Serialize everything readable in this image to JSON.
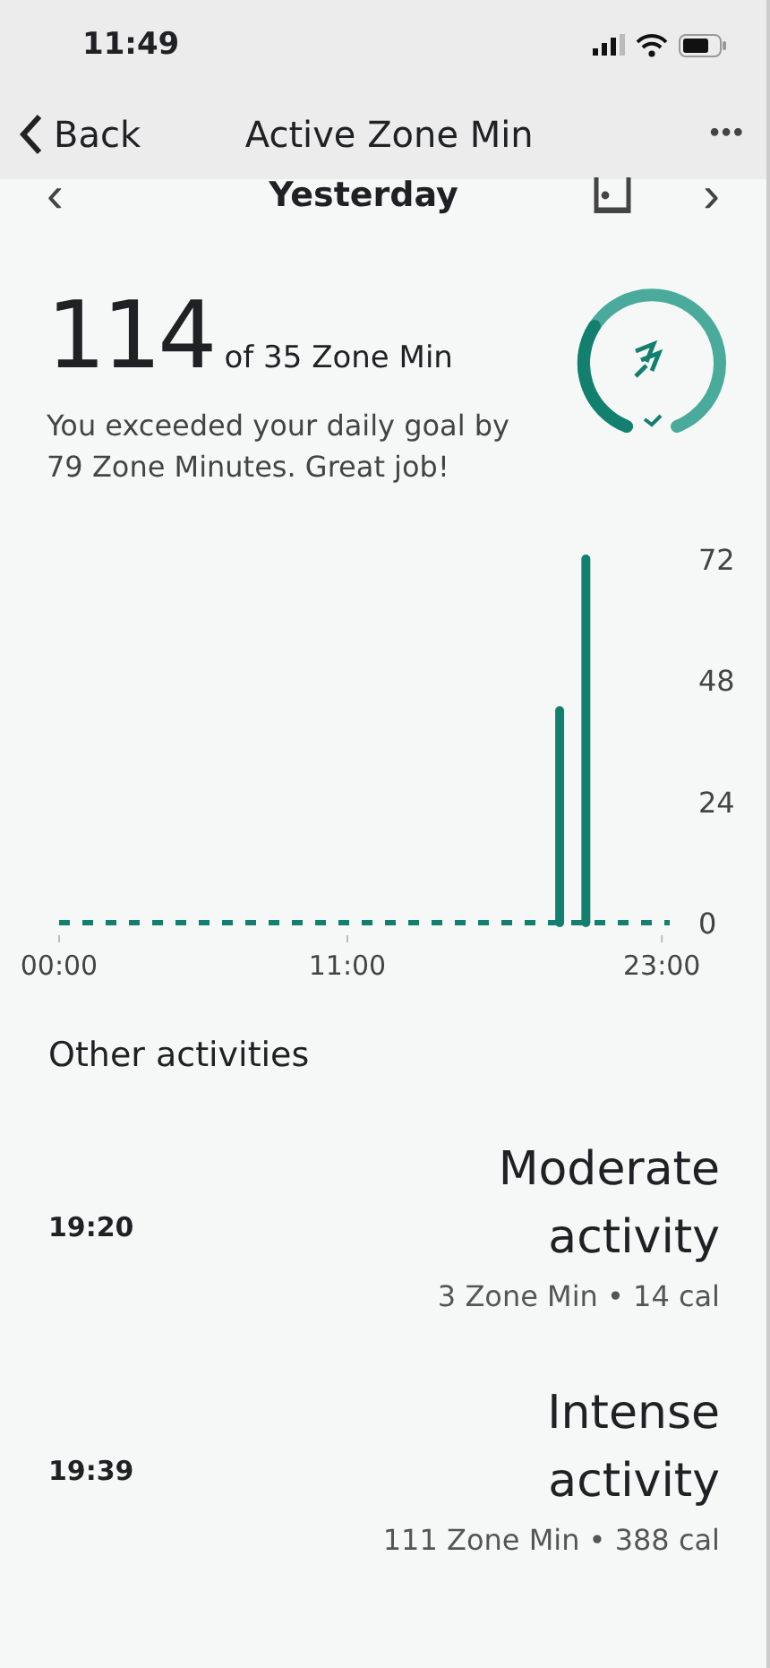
{
  "status_bar": {
    "time": "11:49"
  },
  "nav": {
    "back": "Back",
    "title": "Active Zone Min",
    "more": "•••"
  },
  "date_nav": {
    "prev": "‹",
    "label": "Yesterday",
    "next": "›"
  },
  "summary": {
    "value": "114",
    "goal": "of 35 Zone Min",
    "message": "You exceeded your daily goal by 79 Zone Minutes. Great job!"
  },
  "chart": {
    "chart_data": {
      "type": "bar",
      "x": [
        19.1,
        20.1
      ],
      "values": [
        42,
        72
      ],
      "xlim": [
        0,
        23.3
      ],
      "ylim": [
        0,
        72
      ],
      "xticks": [
        {
          "value": 0,
          "label": "00:00"
        },
        {
          "value": 11,
          "label": "11:00"
        },
        {
          "value": 23,
          "label": "23:00"
        }
      ],
      "yticks": [
        0,
        24,
        48,
        72
      ]
    }
  },
  "section_title": "Other activities",
  "activities": [
    {
      "time": "19:20",
      "title": "Moderate activity",
      "detail": "3 Zone Min • 14 cal"
    },
    {
      "time": "19:39",
      "title": "Intense activity",
      "detail": "111 Zone Min • 388 cal"
    }
  ]
}
